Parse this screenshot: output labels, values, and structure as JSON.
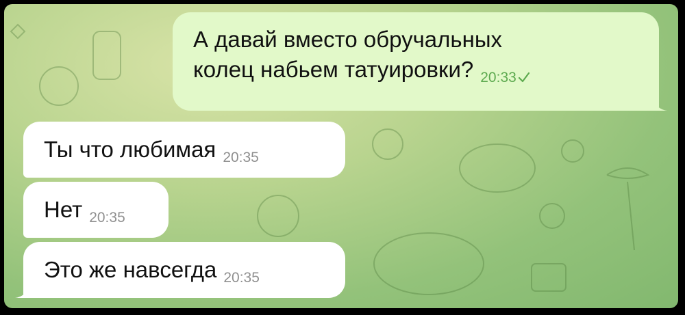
{
  "messages": [
    {
      "text_line1": "А давай вместо обручальных",
      "text_line2": "колец набьем татуировки?",
      "time": "20:33"
    },
    {
      "text": "Ты что любимая",
      "time": "20:35"
    },
    {
      "text": "Нет",
      "time": "20:35"
    },
    {
      "text": "Это же навсегда",
      "time": "20:35"
    }
  ],
  "colors": {
    "outgoing_bubble": "#e2f9c9",
    "incoming_bubble": "#ffffff",
    "background": "#a9cd86",
    "time_out": "#5daa4f"
  },
  "icons": {
    "read_status": "check-icon"
  }
}
